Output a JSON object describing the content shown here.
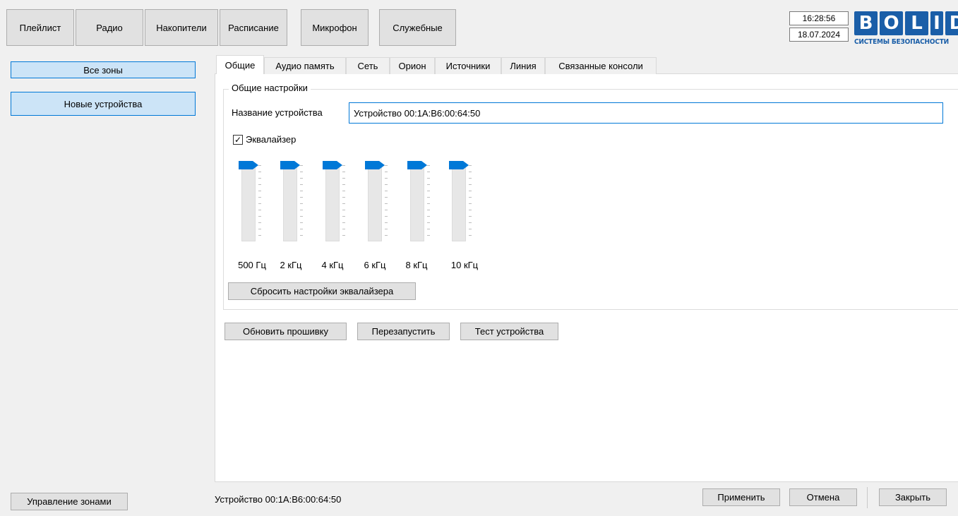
{
  "topnav": {
    "playlist": "Плейлист",
    "radio": "Радио",
    "storage": "Накопители",
    "schedule": "Расписание",
    "microphone": "Микрофон",
    "service": "Служебные"
  },
  "clock": {
    "time": "16:28:56",
    "date": "18.07.2024"
  },
  "logo": {
    "letters": [
      "B",
      "O",
      "L",
      "I",
      "D"
    ],
    "subtitle": "СИСТЕМЫ БЕЗОПАСНОСТИ",
    "color": "#1a5ea8"
  },
  "sidebar": {
    "all_zones": "Все зоны",
    "new_devices": "Новые устройства",
    "manage_zones": "Управление зонами"
  },
  "tabs": {
    "general": "Общие",
    "audio_memory": "Аудио память",
    "network": "Сеть",
    "orion": "Орион",
    "sources": "Источники",
    "line": "Линия",
    "linked_consoles": "Связанные консоли"
  },
  "general_settings": {
    "group_title": "Общие настройки",
    "device_name_label": "Название устройства",
    "device_name_value": "Устройство 00:1A:B6:00:64:50",
    "equalizer_label": "Эквалайзер",
    "equalizer_checked": true,
    "bands": [
      "500 Гц",
      "2 кГц",
      "4 кГц",
      "6 кГц",
      "8 кГц",
      "10 кГц"
    ],
    "reset_button": "Сбросить настройки эквалайзера"
  },
  "actions": {
    "update_firmware": "Обновить прошивку",
    "restart": "Перезапустить",
    "test_device": "Тест устройства"
  },
  "status": {
    "device": "Устройство 00:1A:B6:00:64:50"
  },
  "footer": {
    "apply": "Применить",
    "cancel": "Отмена",
    "close": "Закрыть"
  },
  "colors": {
    "accent": "#0078d7",
    "selection": "#cce4f7"
  }
}
